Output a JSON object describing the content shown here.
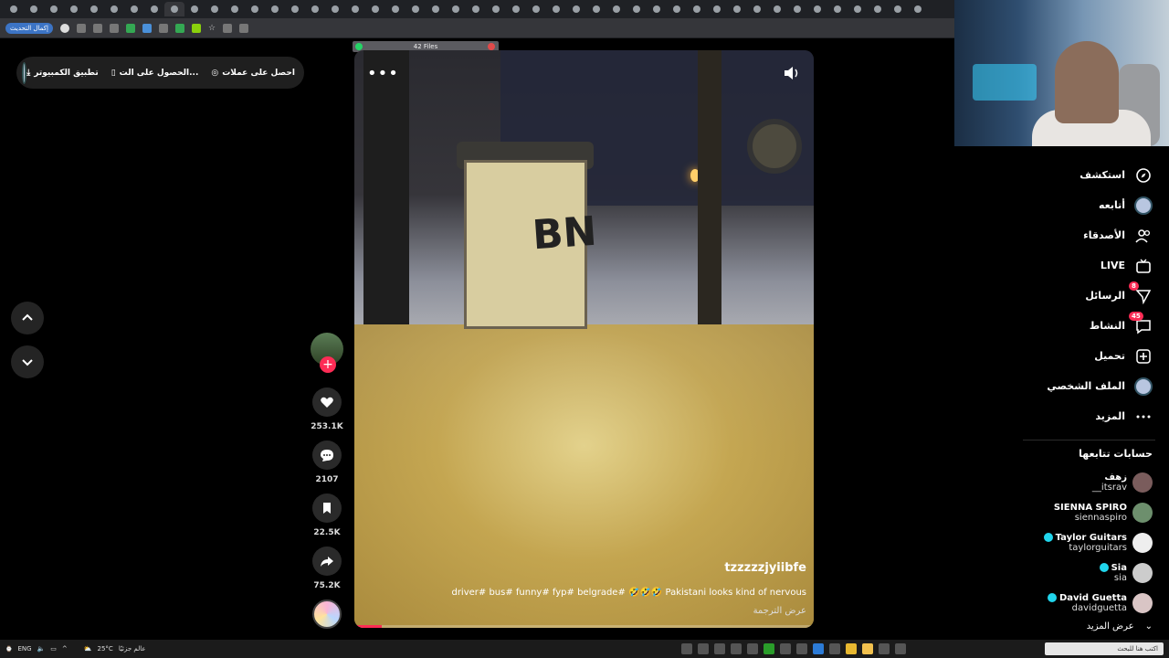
{
  "browser": {
    "tab_count": 46,
    "update_button": "إكمال التحديث"
  },
  "appbar": {
    "coins": "احصل على عملات",
    "get_app": "الحصول على الت...",
    "desktop_app": "تطبيق الكمبيوتر"
  },
  "files_pill": "42 Files",
  "video": {
    "bin_text": "BN",
    "handle": "tzzzzzjyiibfe",
    "caption": "driver# bus# funny# fyp# belgrade# 🤣🤣🤣 Pakistani looks kind of nervous",
    "translate": "عرض الترجمة",
    "progress": 0.06
  },
  "actions": {
    "likes": "253.1K",
    "comments": "2107",
    "saves": "22.5K",
    "shares": "75.2K"
  },
  "sidebar": {
    "items": [
      {
        "label": "استكشف",
        "icon": "compass-icon"
      },
      {
        "label": "أتابعه",
        "icon": "avatar-icon"
      },
      {
        "label": "الأصدقاء",
        "icon": "friends-icon"
      },
      {
        "label": "LIVE",
        "icon": "live-icon"
      },
      {
        "label": "الرسائل",
        "icon": "messages-icon",
        "badge": "8"
      },
      {
        "label": "النشاط",
        "icon": "activity-icon",
        "badge": "45"
      },
      {
        "label": "تحميل",
        "icon": "upload-icon"
      },
      {
        "label": "الملف الشخصي",
        "icon": "profile-icon"
      },
      {
        "label": "المزيد",
        "icon": "more-icon"
      }
    ]
  },
  "following": {
    "title": "حسابات تتابعها",
    "accounts": [
      {
        "name": "زهف",
        "handle": "__itsrav",
        "verified": false
      },
      {
        "name": "SIENNA SPIRO",
        "handle": "siennaspiro",
        "verified": false
      },
      {
        "name": "Taylor Guitars",
        "handle": "taylorguitars",
        "verified": true
      },
      {
        "name": "Sia",
        "handle": "sia",
        "verified": true
      },
      {
        "name": "David Guetta",
        "handle": "davidguetta",
        "verified": true
      }
    ],
    "see_more": "عرض المزيد"
  },
  "taskbar": {
    "weather": "25°C",
    "weather_label": "عالم جزئيًا",
    "lang": "ENG",
    "search_placeholder": "اكتب هنا للبحث"
  },
  "colors": {
    "accent": "#fe2c55",
    "verified": "#20d5ec"
  }
}
